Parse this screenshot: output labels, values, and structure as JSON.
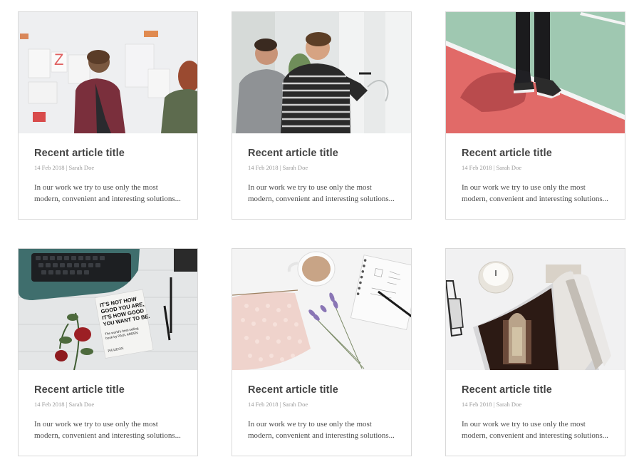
{
  "articles": [
    {
      "title": "Recent article title",
      "meta": "14 Feb 2018 | Sarah Doe",
      "excerpt": "In our work we try to use only the most modern, convenient and interesting solutions...",
      "image": "office-whiteboard-team-photo",
      "image_text": {
        "letter": "Z"
      }
    },
    {
      "title": "Recent article title",
      "meta": "14 Feb 2018 | Sarah Doe",
      "excerpt": "In our work we try to use only the most modern, convenient and interesting solutions...",
      "image": "two-men-writing-on-whiteboard-photo"
    },
    {
      "title": "Recent article title",
      "meta": "14 Feb 2018 | Sarah Doe",
      "excerpt": "In our work we try to use only the most modern, convenient and interesting solutions...",
      "image": "person-standing-on-sports-court-photo"
    },
    {
      "title": "Recent article title",
      "meta": "14 Feb 2018 | Sarah Doe",
      "excerpt": "In our work we try to use only the most modern, convenient and interesting solutions...",
      "image": "typewriter-book-roses-desk-photo",
      "image_text": {
        "book_line1": "IT'S NOT HOW",
        "book_line2": "GOOD YOU ARE,",
        "book_line3": "IT'S HOW GOOD",
        "book_line4": "YOU WANT TO BE.",
        "book_sub1": "The world's best-selling",
        "book_sub2": "book by PAUL ARDEN",
        "book_publisher": "PHAIDON"
      }
    },
    {
      "title": "Recent article title",
      "meta": "14 Feb 2018 | Sarah Doe",
      "excerpt": "In our work we try to use only the most modern, convenient and interesting solutions...",
      "image": "knitting-coffee-notebook-flatlay-photo"
    },
    {
      "title": "Recent article title",
      "meta": "14 Feb 2018 | Sarah Doe",
      "excerpt": "In our work we try to use only the most modern, convenient and interesting solutions...",
      "image": "magazine-candle-glasses-flatlay-photo"
    }
  ],
  "colors": {
    "title": "#444444",
    "meta": "#9a9a9a",
    "text": "#4a4a4a",
    "border": "#d9d9d9"
  }
}
